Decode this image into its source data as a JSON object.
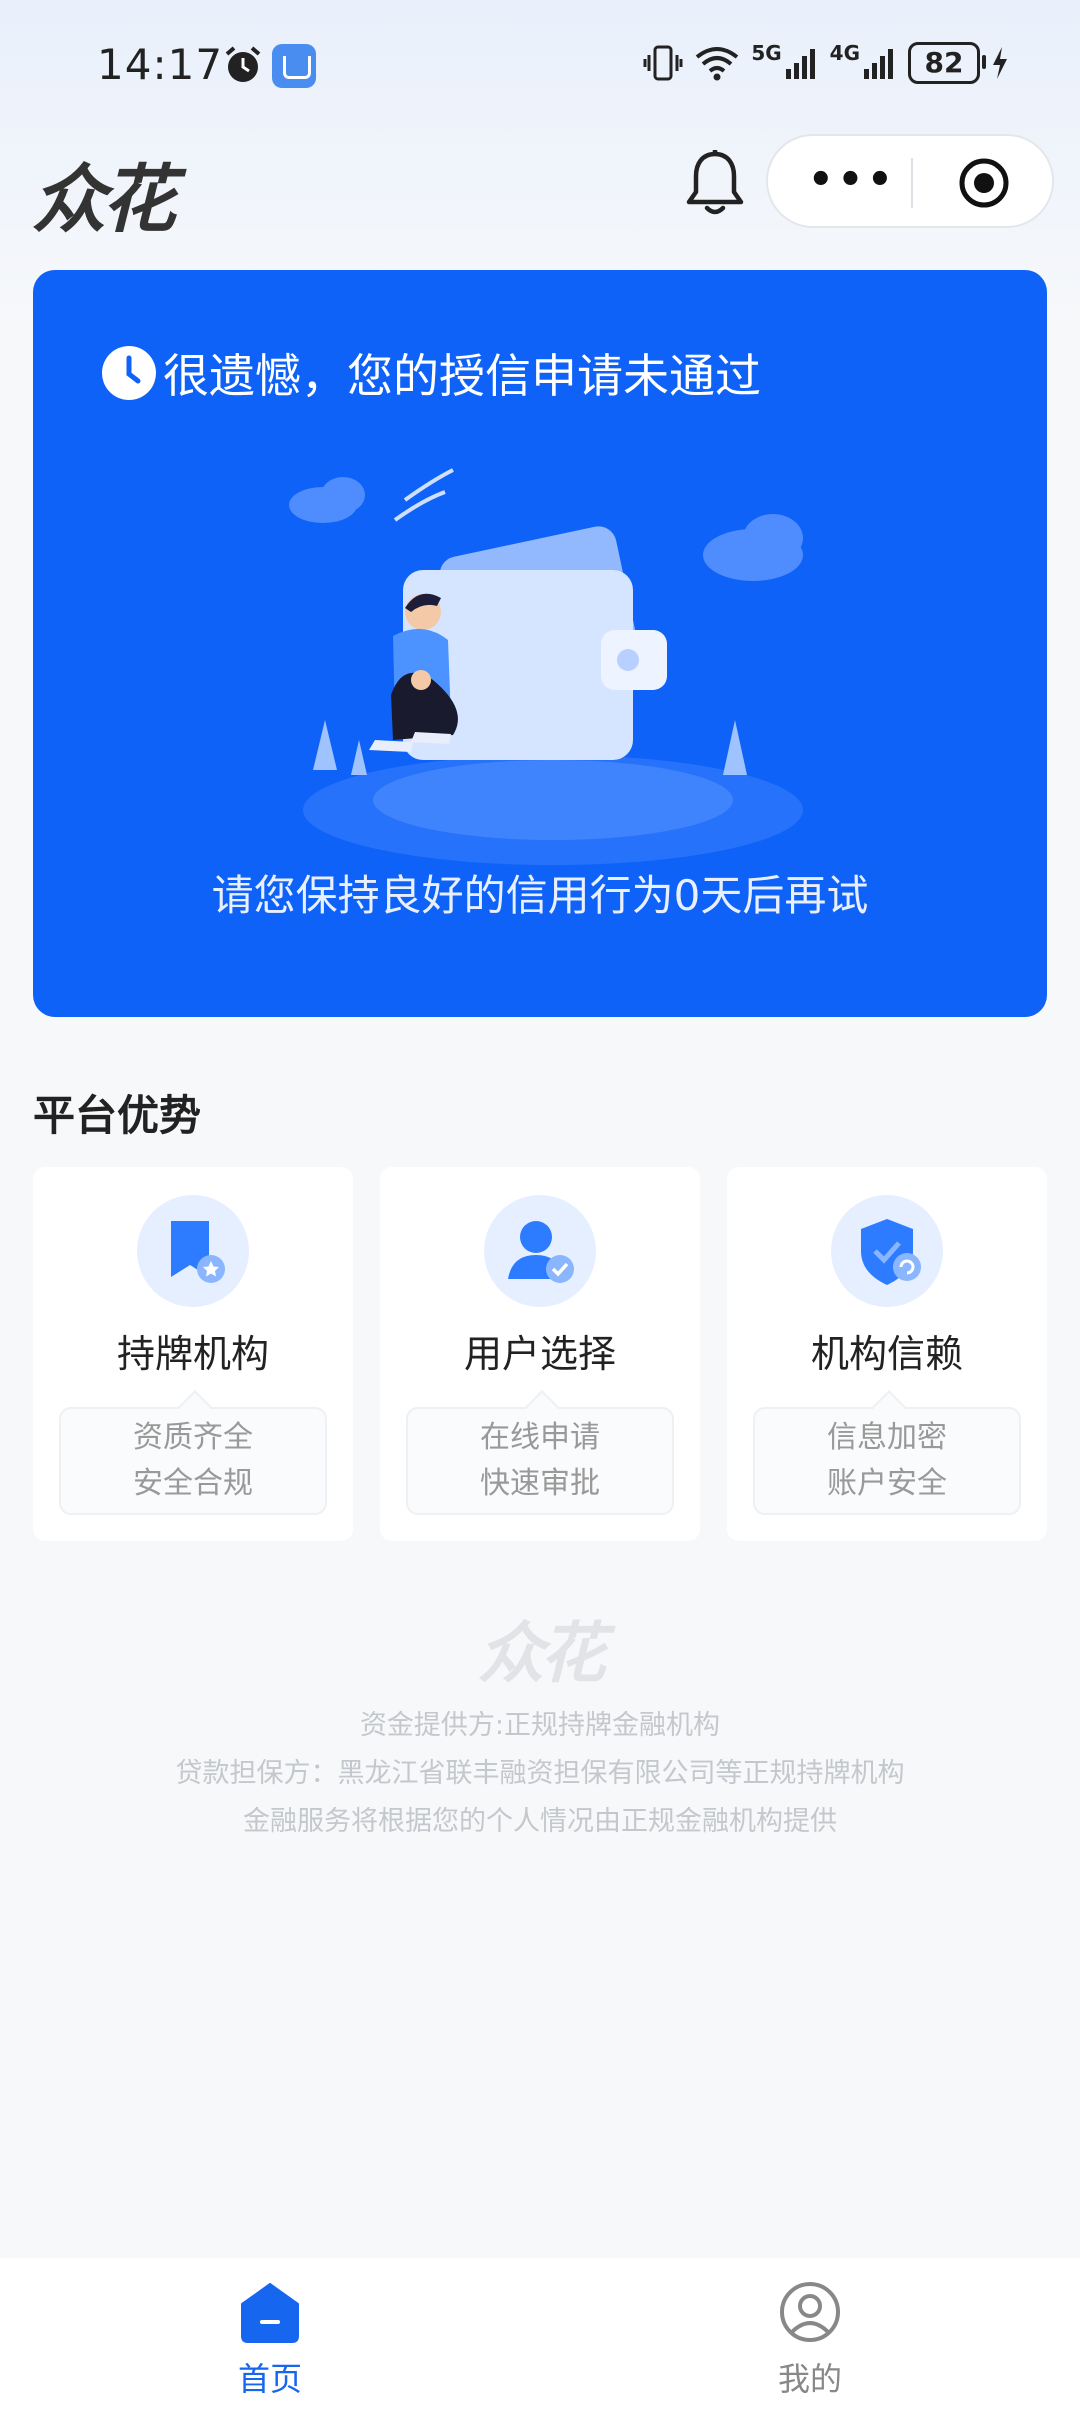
{
  "status_bar": {
    "time": "14:17",
    "network1": "5G",
    "network2": "4G",
    "battery": "82"
  },
  "header": {
    "logo": "众花",
    "bell_icon": "bell-icon",
    "more_icon": "more-icon",
    "target_icon": "target-icon"
  },
  "card": {
    "title": "很遗憾，您的授信申请未通过",
    "subtitle": "请您保持良好的信用行为0天后再试",
    "bg_color": "#0f62f7"
  },
  "advantages": {
    "title": "平台优势",
    "items": [
      {
        "name": "持牌机构",
        "line1": "资质齐全",
        "line2": "安全合规",
        "icon": "bookmark-star-icon"
      },
      {
        "name": "用户选择",
        "line1": "在线申请",
        "line2": "快速审批",
        "icon": "user-check-icon"
      },
      {
        "name": "机构信赖",
        "line1": "信息加密",
        "line2": "账户安全",
        "icon": "shield-icon"
      }
    ]
  },
  "footer": {
    "logo": "众花",
    "line1": "资金提供方:正规持牌金融机构",
    "line2": "贷款担保方：黑龙江省联丰融资担保有限公司等正规持牌机构",
    "line3": "金融服务将根据您的个人情况由正规金融机构提供"
  },
  "nav": {
    "items": [
      {
        "label": "首页",
        "icon": "home-icon",
        "active": true
      },
      {
        "label": "我的",
        "icon": "profile-icon",
        "active": false
      }
    ],
    "accent": "#1766f0"
  }
}
